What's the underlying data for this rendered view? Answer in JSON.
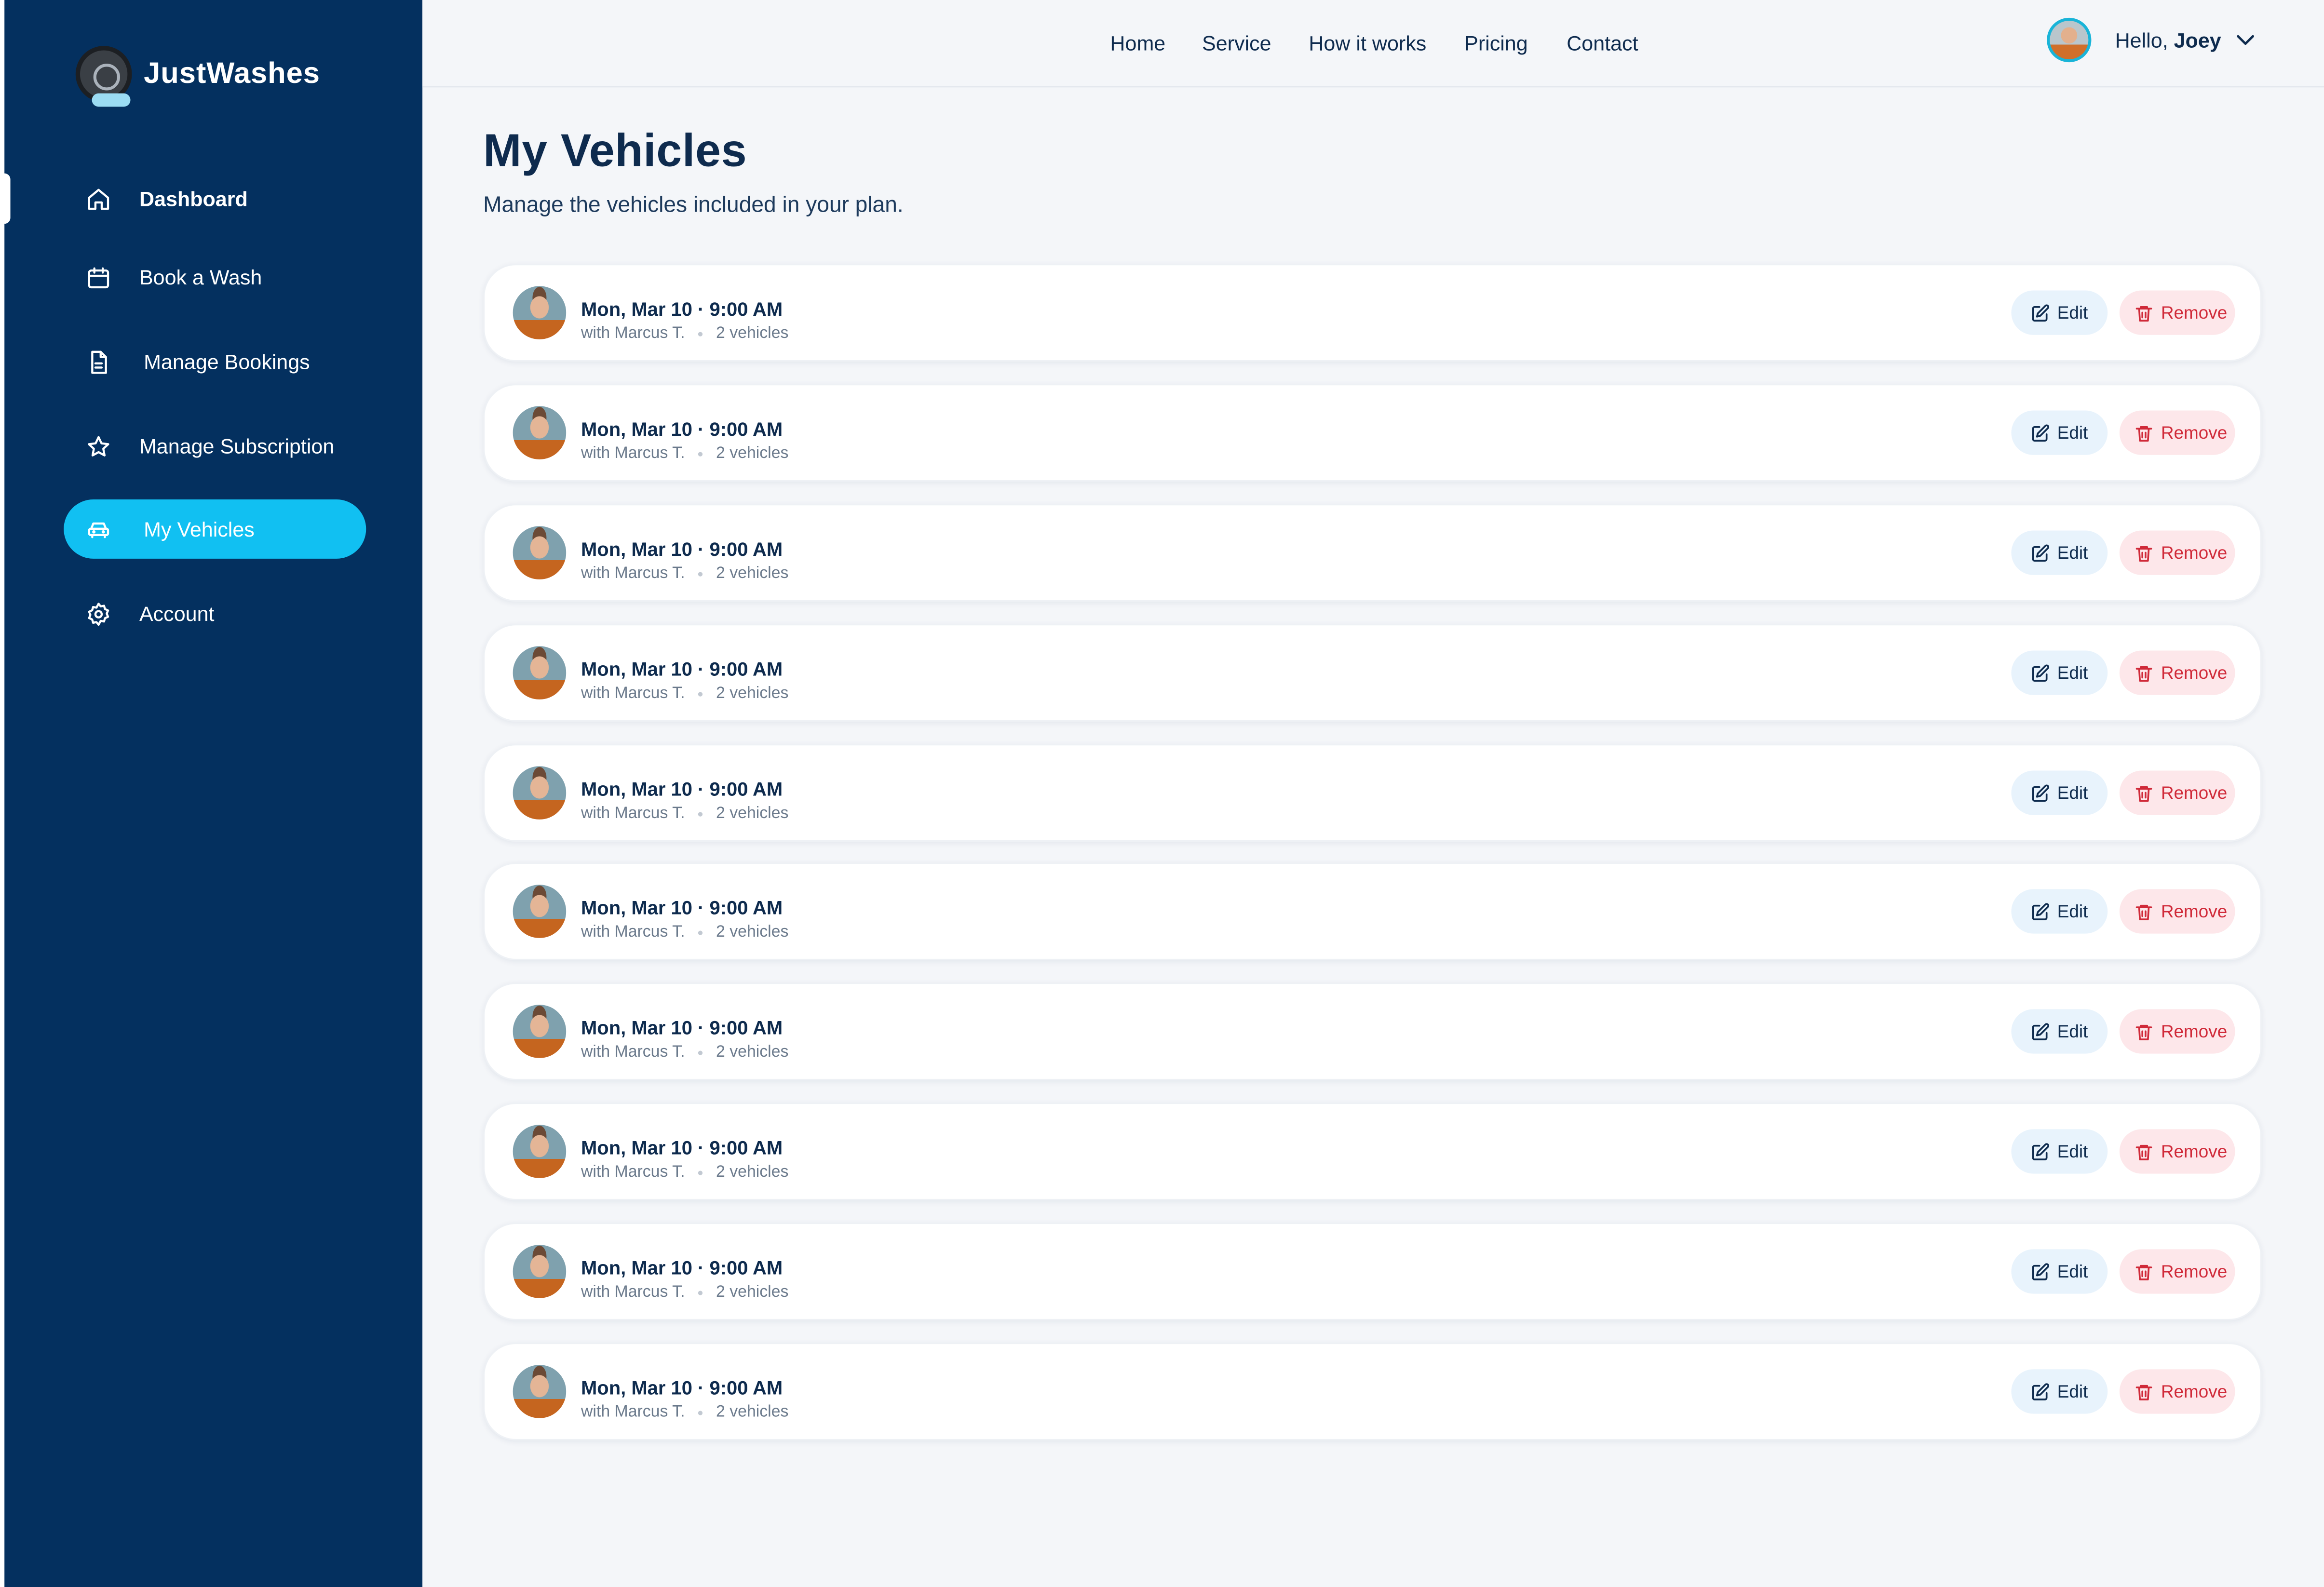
{
  "app": {
    "name": "JustWashes"
  },
  "sidebar": {
    "items": [
      {
        "label": "Dashboard",
        "icon": "home-icon"
      },
      {
        "label": "Book a Wash",
        "icon": "calendar-icon"
      },
      {
        "label": "Manage Bookings",
        "icon": "document-icon"
      },
      {
        "label": "Manage Subscription",
        "icon": "star-icon"
      },
      {
        "label": "My Vehicles",
        "icon": "car-icon",
        "active": true
      },
      {
        "label": "Account",
        "icon": "gear-icon"
      }
    ]
  },
  "topnav": {
    "links": [
      "Home",
      "Service",
      "How it works",
      "Pricing",
      "Contact"
    ]
  },
  "user": {
    "greeting": "Hello,",
    "name": "Joey"
  },
  "page": {
    "title": "My Vehicles",
    "subtitle": "Manage the vehicles included in your plan."
  },
  "vehicles": [
    {
      "when": "Mon, Mar 10 · 9:00 AM",
      "with": "with Marcus T.",
      "count": "2 vehicles"
    },
    {
      "when": "Mon, Mar 10 · 9:00 AM",
      "with": "with Marcus T.",
      "count": "2 vehicles"
    },
    {
      "when": "Mon, Mar 10 · 9:00 AM",
      "with": "with Marcus T.",
      "count": "2 vehicles"
    },
    {
      "when": "Mon, Mar 10 · 9:00 AM",
      "with": "with Marcus T.",
      "count": "2 vehicles"
    },
    {
      "when": "Mon, Mar 10 · 9:00 AM",
      "with": "with Marcus T.",
      "count": "2 vehicles"
    },
    {
      "when": "Mon, Mar 10 · 9:00 AM",
      "with": "with Marcus T.",
      "count": "2 vehicles"
    },
    {
      "when": "Mon, Mar 10 · 9:00 AM",
      "with": "with Marcus T.",
      "count": "2 vehicles"
    },
    {
      "when": "Mon, Mar 10 · 9:00 AM",
      "with": "with Marcus T.",
      "count": "2 vehicles"
    },
    {
      "when": "Mon, Mar 10 · 9:00 AM",
      "with": "with Marcus T.",
      "count": "2 vehicles"
    },
    {
      "when": "Mon, Mar 10 · 9:00 AM",
      "with": "with Marcus T.",
      "count": "2 vehicles"
    }
  ],
  "actions": {
    "edit_label": "Edit",
    "remove_label": "Remove"
  },
  "colors": {
    "sidebar": "#04305f",
    "accent": "#11c0f2",
    "text": "#0e2b4e",
    "remove": "#d02a39"
  }
}
